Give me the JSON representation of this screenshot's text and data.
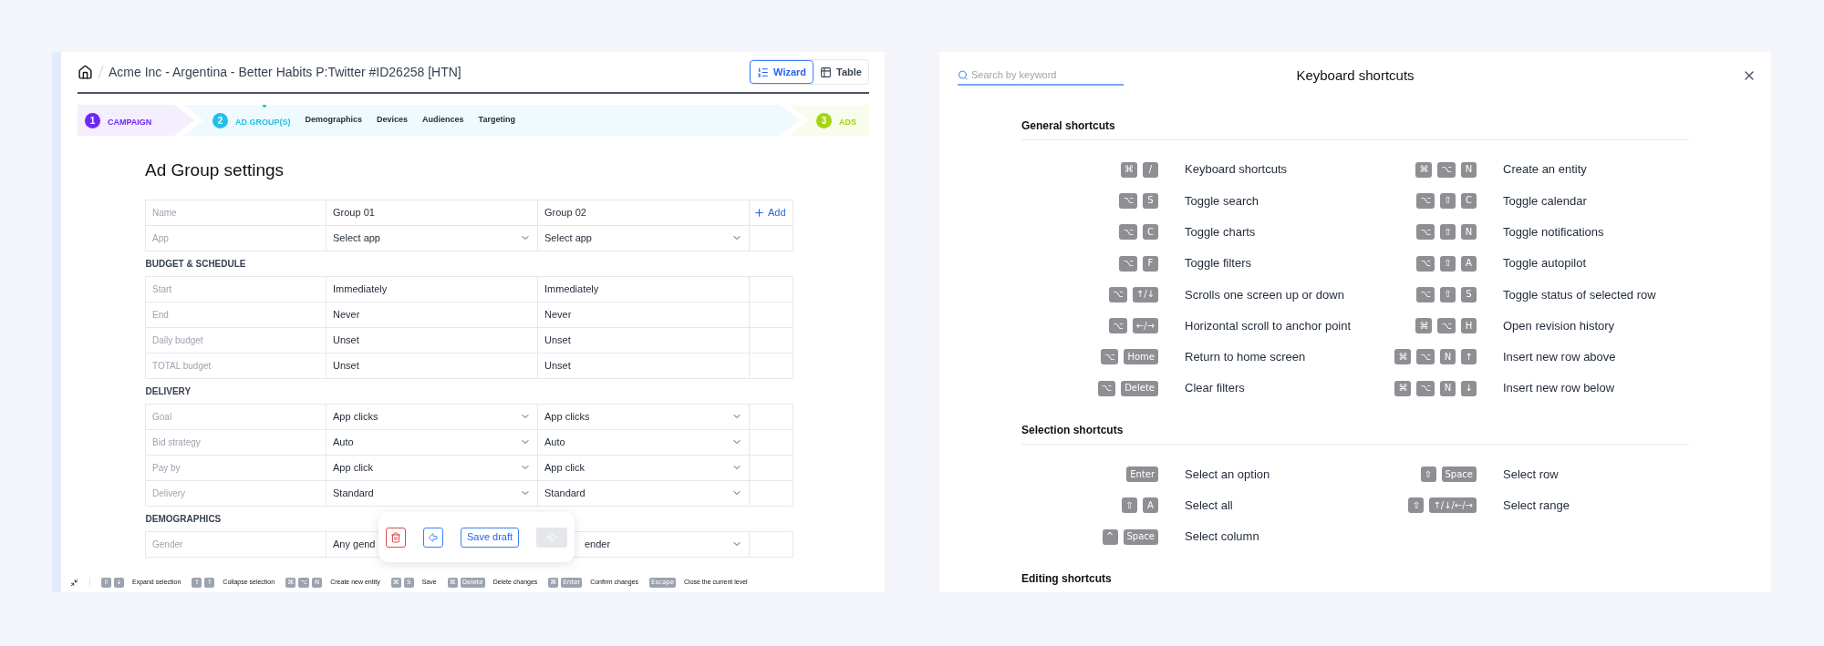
{
  "breadcrumb": {
    "title": "Acme Inc - Argentina - Better Habits P:Twitter #ID26258 [HTN]"
  },
  "view_toggle": [
    {
      "kind": "wizard",
      "label": "Wizard",
      "selected": true
    },
    {
      "kind": "table",
      "label": "Table",
      "selected": false
    }
  ],
  "steps": [
    {
      "number": "1",
      "label": "CAMPAIGN",
      "color": "#6d28f5",
      "selected": false
    },
    {
      "number": "2",
      "label": "AD GROUP(S)",
      "color": "#22c0e8",
      "selected": true,
      "substeps": [
        "Demographics",
        "Devices",
        "Audiences",
        "Targeting"
      ]
    },
    {
      "number": "3",
      "label": "ADS",
      "color": "#a6d40f",
      "selected": false
    }
  ],
  "heading": "Ad Group settings",
  "table": {
    "add_label": "Add",
    "rows": [
      {
        "kind": "field",
        "label": "Name",
        "values": [
          "Group 01",
          "Group 02"
        ],
        "dropdown": false
      },
      {
        "kind": "field",
        "label": "App",
        "values": [
          "Select app",
          "Select app"
        ],
        "dropdown": true
      },
      {
        "kind": "section",
        "label": "BUDGET & SCHEDULE"
      },
      {
        "kind": "field",
        "label": "Start",
        "values": [
          "Immediately",
          "Immediately"
        ],
        "dropdown": false
      },
      {
        "kind": "field",
        "label": "End",
        "values": [
          "Never",
          "Never"
        ],
        "dropdown": false
      },
      {
        "kind": "field",
        "label": "Daily budget",
        "values": [
          "Unset",
          "Unset"
        ],
        "dropdown": false
      },
      {
        "kind": "field",
        "label": "TOTAL budget",
        "values": [
          "Unset",
          "Unset"
        ],
        "dropdown": false
      },
      {
        "kind": "section",
        "label": "DELIVERY"
      },
      {
        "kind": "field",
        "label": "Goal",
        "values": [
          "App clicks",
          "App clicks"
        ],
        "dropdown": true
      },
      {
        "kind": "field",
        "label": "Bid strategy",
        "values": [
          "Auto",
          "Auto"
        ],
        "dropdown": true
      },
      {
        "kind": "field",
        "label": "Pay by",
        "values": [
          "App click",
          "App click"
        ],
        "dropdown": true
      },
      {
        "kind": "field",
        "label": "Delivery",
        "values": [
          "Standard",
          "Standard"
        ],
        "dropdown": true
      },
      {
        "kind": "section",
        "label": "DEMOGRAPHICS"
      },
      {
        "kind": "covered_field",
        "label": "Gender",
        "values": [
          "Any gend",
          "ender"
        ],
        "dropdown": true
      }
    ]
  },
  "toolbar": [
    {
      "kind": "delete",
      "disabled": false
    },
    {
      "kind": "back",
      "disabled": false
    },
    {
      "kind": "save",
      "label": "Save draft",
      "disabled": false
    },
    {
      "kind": "forward",
      "disabled": true
    }
  ],
  "status_bar": [
    {
      "keys": [
        "⇧",
        "↓"
      ],
      "label": "Expand selection"
    },
    {
      "keys": [
        "⇧",
        "↑"
      ],
      "label": "Collapse selection"
    },
    {
      "keys": [
        "⌘",
        "⌥",
        "N"
      ],
      "label": "Create new entity"
    },
    {
      "keys": [
        "⌘",
        "S"
      ],
      "label": "Save"
    },
    {
      "keys": [
        "⌘",
        "Delete"
      ],
      "label": "Delete changes"
    },
    {
      "keys": [
        "⌘",
        "Enter"
      ],
      "label": "Confirm changes"
    },
    {
      "keys": [
        "Escape"
      ],
      "label": "Close the current level"
    }
  ],
  "shortcuts_panel": {
    "search": {
      "placeholder": "Search by keyword"
    },
    "title": "Keyboard shortcuts",
    "sections": [
      {
        "title": "General shortcuts",
        "shortcuts": [
          {
            "keys": [
              "⌘",
              "/"
            ],
            "label": "Keyboard shortcuts"
          },
          {
            "keys": [
              "⌘",
              "⌥",
              "N"
            ],
            "label": "Create an entity"
          },
          {
            "keys": [
              "⌥",
              "S"
            ],
            "label": "Toggle search"
          },
          {
            "keys": [
              "⌥",
              "⇧",
              "C"
            ],
            "label": "Toggle calendar"
          },
          {
            "keys": [
              "⌥",
              "C"
            ],
            "label": "Toggle charts"
          },
          {
            "keys": [
              "⌥",
              "⇧",
              "N"
            ],
            "label": "Toggle notifications"
          },
          {
            "keys": [
              "⌥",
              "F"
            ],
            "label": "Toggle filters"
          },
          {
            "keys": [
              "⌥",
              "⇧",
              "A"
            ],
            "label": "Toggle autopilot"
          },
          {
            "keys": [
              "⌥",
              "↑/↓"
            ],
            "label": "Scrolls one screen up or down"
          },
          {
            "keys": [
              "⌥",
              "⇧",
              "S"
            ],
            "label": "Toggle status of selected row"
          },
          {
            "keys": [
              "⌥",
              "←/→"
            ],
            "label": "Horizontal scroll to anchor point"
          },
          {
            "keys": [
              "⌘",
              "⌥",
              "H"
            ],
            "label": "Open revision history"
          },
          {
            "keys": [
              "⌥",
              "Home"
            ],
            "label": "Return to home screen"
          },
          {
            "keys": [
              "⌘",
              "⌥",
              "N",
              "↑"
            ],
            "label": "Insert new row above"
          },
          {
            "keys": [
              "⌥",
              "Delete"
            ],
            "label": "Clear filters"
          },
          {
            "keys": [
              "⌘",
              "⌥",
              "N",
              "↓"
            ],
            "label": "Insert new row below"
          }
        ]
      },
      {
        "title": "Selection shortcuts",
        "shortcuts": [
          {
            "keys": [
              "Enter"
            ],
            "label": "Select an option"
          },
          {
            "keys": [
              "⇧",
              "Space"
            ],
            "label": "Select row"
          },
          {
            "keys": [
              "⇧",
              "A"
            ],
            "label": "Select all"
          },
          {
            "keys": [
              "⇧",
              "↑/↓/←/→"
            ],
            "label": "Select range"
          },
          {
            "keys": [
              "^",
              "Space"
            ],
            "label": "Select column"
          }
        ]
      },
      {
        "title": "Editing shortcuts"
      }
    ]
  }
}
